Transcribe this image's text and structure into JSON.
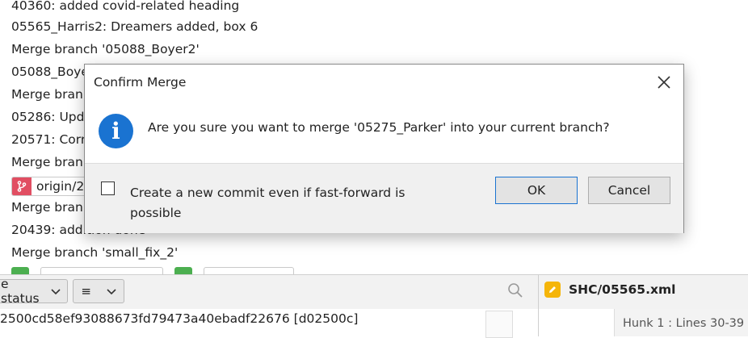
{
  "commit_list": {
    "rows": [
      "40360: added covid-related heading",
      "05565_Harris2: Dreamers added, box 6",
      "Merge branch '05088_Boyer2'",
      "05088_Boye",
      "Merge bran",
      "05286: Upd",
      "20571: Corr",
      "Merge bran",
      "Merge bran",
      "20439: addition done",
      "Merge branch 'small_fix_2'"
    ],
    "ref_tag": "origin/2",
    "ref_tag_color": "#e14e62"
  },
  "toolbar": {
    "status_label": "e status",
    "menu_glyph": "≡",
    "file_tab": "SHC/05565.xml",
    "file_icon_color": "#f5b50a"
  },
  "bottom": {
    "commit_hash": "2500cd58ef93088673fd79473a40ebadf22676 [d02500c]",
    "hunk_label": "Hunk 1 : Lines 30-39"
  },
  "dialog": {
    "title": "Confirm Merge",
    "message": "Are you sure you want to merge '05275_Parker' into your current branch?",
    "checkbox_label": "Create a new commit even if fast-forward is possible",
    "checkbox_checked": false,
    "ok_label": "OK",
    "cancel_label": "Cancel",
    "info_icon_color": "#1a73d1"
  }
}
